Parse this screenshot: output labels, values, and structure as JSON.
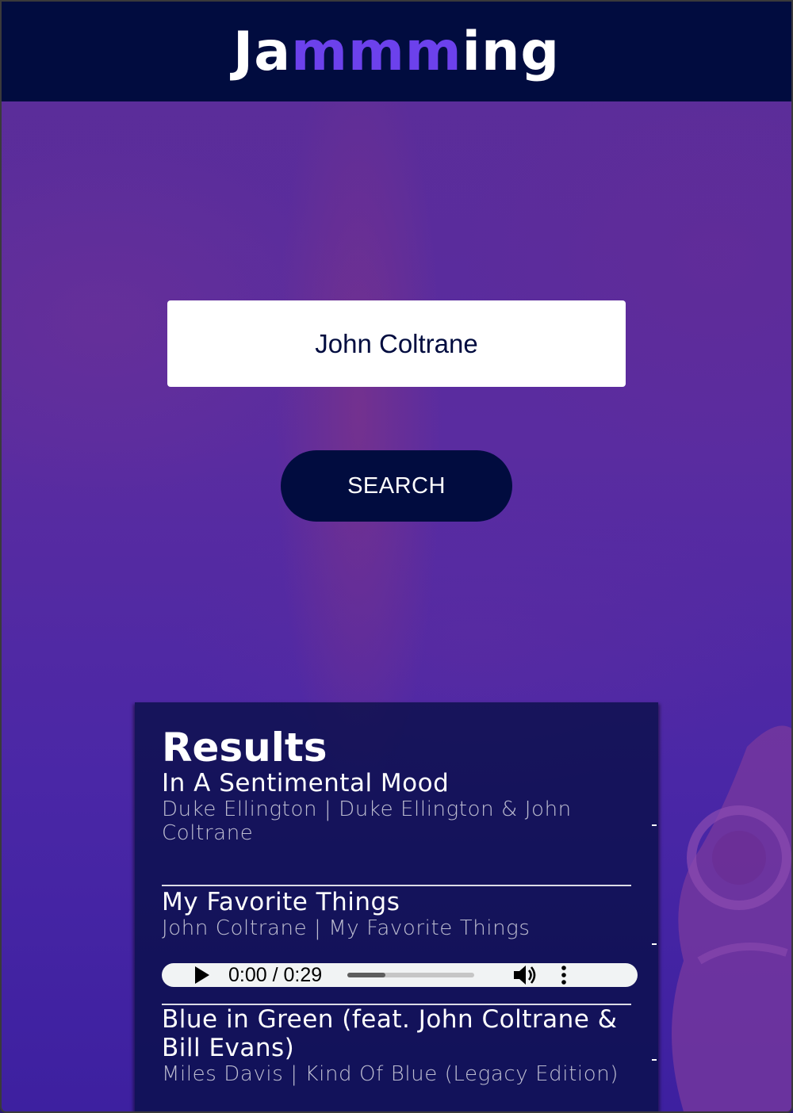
{
  "header": {
    "logo_prefix": "Ja",
    "logo_accent": "mmm",
    "logo_suffix": "ing"
  },
  "search": {
    "value": "John Coltrane",
    "button_label": "SEARCH"
  },
  "results": {
    "title": "Results",
    "tracks": [
      {
        "name": "In A Sentimental Mood",
        "info": "Duke Ellington | Duke Ellington & John Coltrane"
      },
      {
        "name": "My Favorite Things",
        "info": "John Coltrane | My Favorite Things",
        "audio": {
          "time": "0:00 / 0:29",
          "progress": 0.3
        }
      },
      {
        "name": "Blue in Green (feat. John Coltrane & Bill Evans)",
        "info": "Miles Davis | Kind Of Blue (Legacy Edition)"
      }
    ]
  },
  "colors": {
    "header_bg": "#010c3f",
    "logo_accent": "#6c41ec",
    "button_bg": "#010c3f",
    "results_bg": "#010c3f",
    "page_bg": "#5a2ca0"
  }
}
